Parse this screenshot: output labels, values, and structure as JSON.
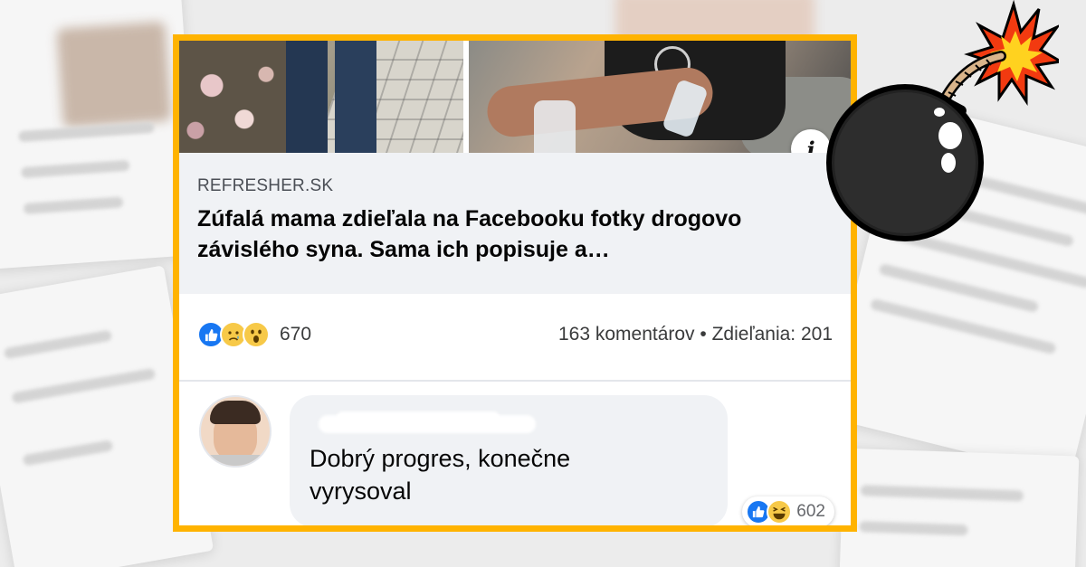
{
  "post": {
    "link_domain": "REFRESHER.SK",
    "link_title": "Zúfalá mama zdieľala na Facebooku fotky drogovo závislého syna. Sama ich popisuje a…",
    "info_icon": "i",
    "reactions": {
      "icons": [
        "like-icon",
        "sad-icon",
        "wow-icon"
      ],
      "count": "670"
    },
    "comments_text": "163 komentárov",
    "separator": "•",
    "shares_text": "Zdieľania: 201"
  },
  "comment": {
    "text_line1": "Dobrý progres, konečne",
    "text_line2": "vyrysoval",
    "reactions": {
      "icons": [
        "like-icon",
        "haha-icon"
      ],
      "count": "602"
    }
  },
  "colors": {
    "frame": "#ffb300",
    "facebook_blue": "#1877f2",
    "link_bg": "#f0f2f5"
  }
}
